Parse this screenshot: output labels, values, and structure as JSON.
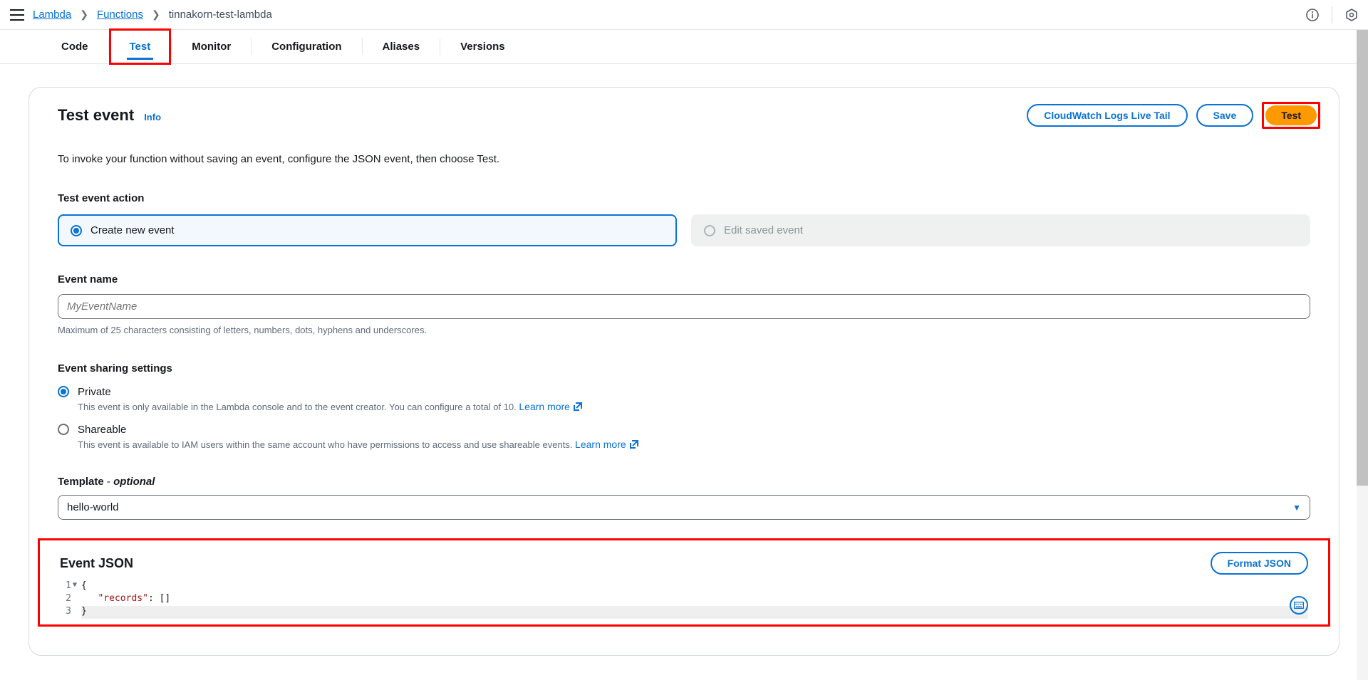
{
  "breadcrumb": {
    "root": "Lambda",
    "mid": "Functions",
    "current": "tinnakorn-test-lambda"
  },
  "tabs": [
    "Code",
    "Test",
    "Monitor",
    "Configuration",
    "Aliases",
    "Versions"
  ],
  "panel": {
    "title": "Test event",
    "info": "Info",
    "buttons": {
      "logs": "CloudWatch Logs Live Tail",
      "save": "Save",
      "test": "Test"
    },
    "description": "To invoke your function without saving an event, configure the JSON event, then choose Test."
  },
  "action": {
    "label": "Test event action",
    "create": "Create new event",
    "edit": "Edit saved event"
  },
  "event_name": {
    "label": "Event name",
    "placeholder": "MyEventName",
    "hint": "Maximum of 25 characters consisting of letters, numbers, dots, hyphens and underscores."
  },
  "sharing": {
    "label": "Event sharing settings",
    "private": "Private",
    "private_desc": "This event is only available in the Lambda console and to the event creator. You can configure a total of 10.",
    "shareable": "Shareable",
    "shareable_desc": "This event is available to IAM users within the same account who have permissions to access and use shareable events.",
    "learn_more": "Learn more"
  },
  "template": {
    "label_b": "Template",
    "label_sep": " - ",
    "label_i": "optional",
    "value": "hello-world"
  },
  "json": {
    "title": "Event JSON",
    "format": "Format JSON",
    "line1": "{",
    "line2_key": "\"records\"",
    "line2_rest": ": []",
    "line3": "}"
  }
}
